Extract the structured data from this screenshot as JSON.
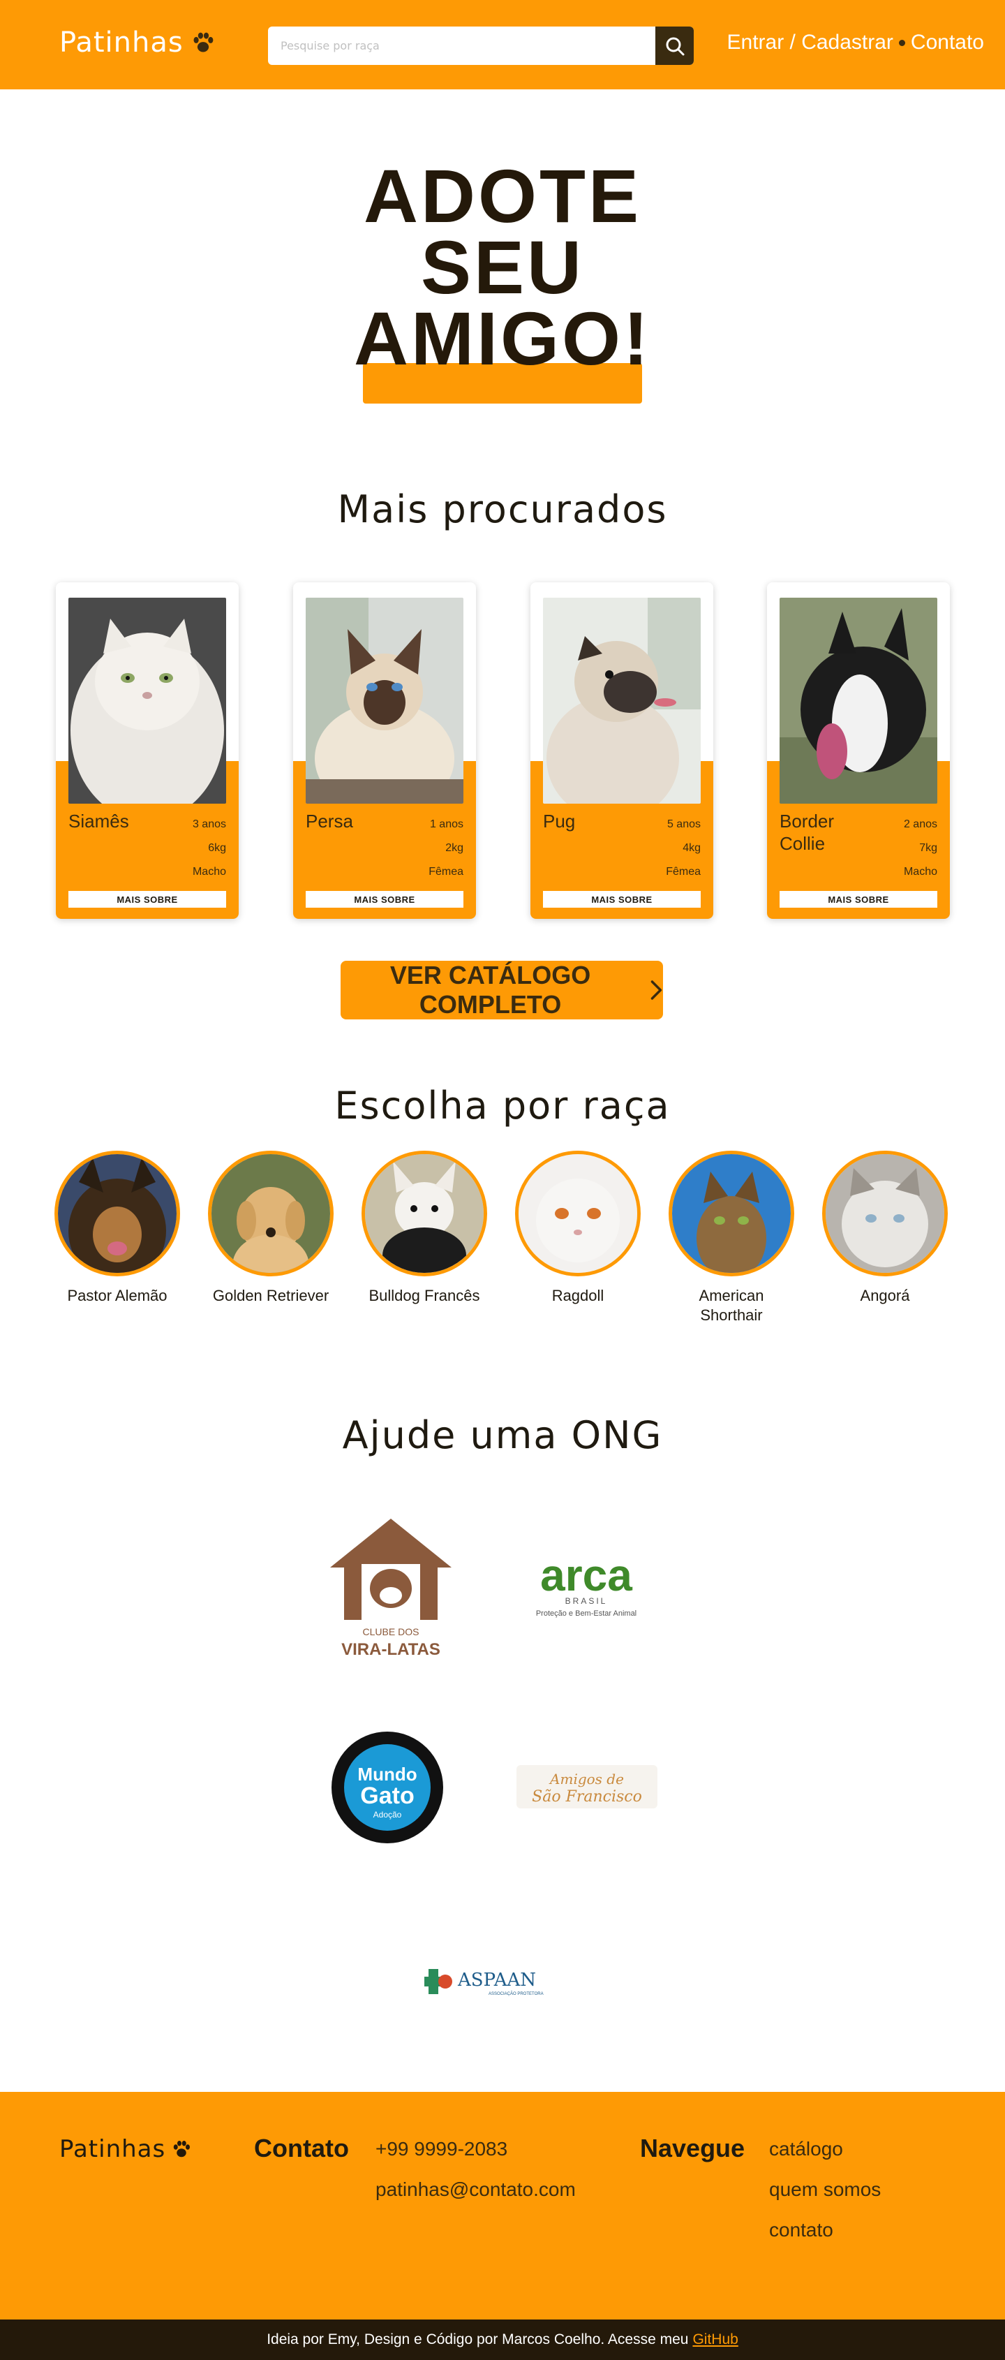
{
  "header": {
    "logo": "Patinhas",
    "search_placeholder": "Pesquise por raça",
    "nav_login": "Entrar / Cadastrar",
    "nav_contact": "Contato"
  },
  "hero": {
    "line1": "Adote",
    "line2": "seu",
    "line3": "amigo!"
  },
  "popular": {
    "title": "Mais procurados",
    "cards": [
      {
        "name": "Siamês",
        "age": "3 anos",
        "weight": "6kg",
        "sex": "Macho",
        "button": "MAIS SOBRE"
      },
      {
        "name": "Persa",
        "age": "1 anos",
        "weight": "2kg",
        "sex": "Fêmea",
        "button": "MAIS SOBRE"
      },
      {
        "name": "Pug",
        "age": "5 anos",
        "weight": "4kg",
        "sex": "Fêmea",
        "button": "MAIS SOBRE"
      },
      {
        "name": "Border Collie",
        "age": "2 anos",
        "weight": "7kg",
        "sex": "Macho",
        "button": "MAIS SOBRE"
      }
    ],
    "catalog_button": "VER CATÁLOGO COMPLETO"
  },
  "breeds": {
    "title": "Escolha por raça",
    "items": [
      {
        "name": "Pastor Alemão"
      },
      {
        "name": "Golden Retriever"
      },
      {
        "name": "Bulldog Francês"
      },
      {
        "name": "Ragdoll"
      },
      {
        "name": "American Shorthair"
      },
      {
        "name": "Angorá"
      }
    ]
  },
  "ong": {
    "title": "Ajude uma ONG",
    "logos": [
      "Clube dos Vira-Latas",
      "arca BRASIL Proteção e Bem-Estar Animal",
      "Mundo Gato Adoção",
      "Amigos de São Francisco",
      "ASPAAN"
    ]
  },
  "footer": {
    "logo": "Patinhas",
    "contact_title": "Contato",
    "phone": "+99 9999-2083",
    "email": "patinhas@contato.com",
    "nav_title": "Navegue",
    "nav_items": [
      "catálogo",
      "quem somos",
      "contato"
    ],
    "credits": "Ideia por Emy, Design e Código por Marcos Coelho. Acesse meu",
    "credits_link": "GitHub"
  },
  "colors": {
    "primary": "#fe9a05",
    "dark": "#24190a",
    "brown": "#3a2b10"
  }
}
